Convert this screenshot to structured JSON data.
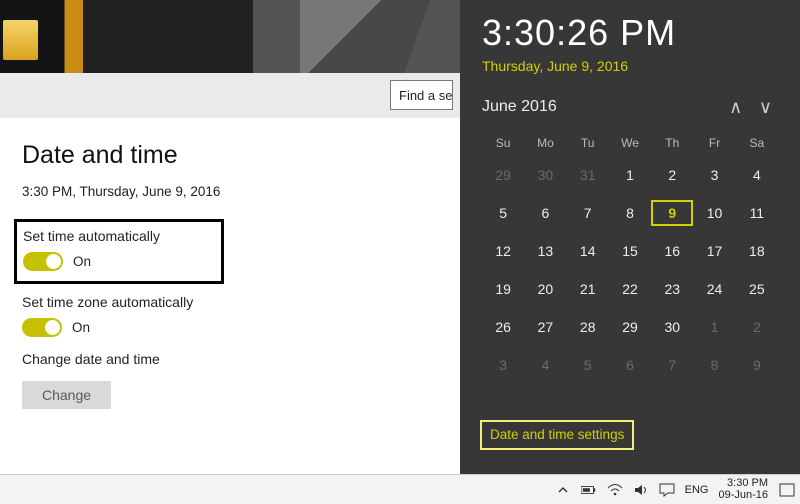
{
  "toolbar": {
    "search_placeholder": "Find a se"
  },
  "settings": {
    "title": "Date and time",
    "clock_line": "3:30 PM, Thursday, June 9, 2016",
    "set_time_auto": {
      "label": "Set time automatically",
      "state": "On"
    },
    "set_tz_auto": {
      "label": "Set time zone automatically",
      "state": "On"
    },
    "change_section": {
      "label": "Change date and time",
      "button": "Change"
    }
  },
  "calendar": {
    "time": "3:30:26 PM",
    "date_line": "Thursday, June 9, 2016",
    "month_label": "June 2016",
    "dow": [
      "Su",
      "Mo",
      "Tu",
      "We",
      "Th",
      "Fr",
      "Sa"
    ],
    "weeks": [
      [
        {
          "n": "29",
          "dim": true
        },
        {
          "n": "30",
          "dim": true
        },
        {
          "n": "31",
          "dim": true
        },
        {
          "n": "1"
        },
        {
          "n": "2"
        },
        {
          "n": "3"
        },
        {
          "n": "4"
        }
      ],
      [
        {
          "n": "5"
        },
        {
          "n": "6"
        },
        {
          "n": "7"
        },
        {
          "n": "8"
        },
        {
          "n": "9",
          "today": true
        },
        {
          "n": "10"
        },
        {
          "n": "11"
        }
      ],
      [
        {
          "n": "12"
        },
        {
          "n": "13"
        },
        {
          "n": "14"
        },
        {
          "n": "15"
        },
        {
          "n": "16"
        },
        {
          "n": "17"
        },
        {
          "n": "18"
        }
      ],
      [
        {
          "n": "19"
        },
        {
          "n": "20"
        },
        {
          "n": "21"
        },
        {
          "n": "22"
        },
        {
          "n": "23"
        },
        {
          "n": "24"
        },
        {
          "n": "25"
        }
      ],
      [
        {
          "n": "26"
        },
        {
          "n": "27"
        },
        {
          "n": "28"
        },
        {
          "n": "29"
        },
        {
          "n": "30"
        },
        {
          "n": "1",
          "dim": true
        },
        {
          "n": "2",
          "dim": true
        }
      ],
      [
        {
          "n": "3",
          "dim": true
        },
        {
          "n": "4",
          "dim": true
        },
        {
          "n": "5",
          "dim": true
        },
        {
          "n": "6",
          "dim": true
        },
        {
          "n": "7",
          "dim": true
        },
        {
          "n": "8",
          "dim": true
        },
        {
          "n": "9",
          "dim": true
        }
      ]
    ],
    "settings_link": "Date and time settings"
  },
  "tray": {
    "lang": "ENG",
    "time": "3:30 PM",
    "date": "09-Jun-16"
  }
}
